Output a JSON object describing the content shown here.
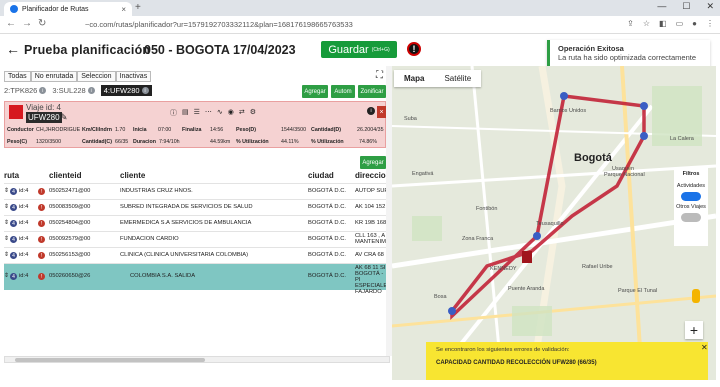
{
  "browser": {
    "tab_title": "Planificador de Rutas",
    "url": "~co.com/rutas/planificador?ur=1579192703332112&plan=168176198665763533"
  },
  "header": {
    "title": "Prueba planificación",
    "code_city": "050 - BOGOTA",
    "date": "17/04/2023",
    "save_label": "Guardar",
    "save_shortcut": "(Ctrl+G)",
    "alert_icon": "!"
  },
  "toast": {
    "title": "Operación Exitosa",
    "message": "La ruta ha sido optimizada correctamente"
  },
  "filters": [
    "Todas",
    "No enrutada",
    "Seleccion",
    "Inactivas"
  ],
  "trip_tabs": [
    {
      "label": "2:TPK826",
      "active": false
    },
    {
      "label": "3:SUL228",
      "active": false
    },
    {
      "label": "4:UFW280",
      "active": true
    }
  ],
  "actions": {
    "add": "Agregar",
    "auto": "Autom",
    "zone": "Zonificar",
    "add2": "Agregar"
  },
  "trip": {
    "id_label": "Viaje id: 4",
    "plate": "UFW280",
    "fields": {
      "conductor_k": "Conductor",
      "conductor_v": "CH,JHRODRIGUE",
      "km_k": "Km/Clilndrn",
      "km_v": "1.70",
      "inicio_k": "Inicia",
      "inicio_v": "07:00",
      "finaliza_k": "Finaliza",
      "finaliza_v": "14:56",
      "peso_k": "Peso(D)",
      "peso_v": "1544/3500",
      "cantidad_k": "Cantidad(D)",
      "cantidad_v": "26.2004/35",
      "pesoc_k": "Peso(C)",
      "pesoc_v": "1320/3500",
      "cantc_k": "Cantidad(C)",
      "cantc_v": "66/35",
      "dur_k": "Duracion",
      "dur_v": "7:94/10h",
      "dist_v": "44.59km",
      "util_k": "% Utilización",
      "util_v": "44.11%",
      "util2_k": "% Utilización",
      "util2_v": "74.86%"
    }
  },
  "table": {
    "headers": [
      "ruta",
      "clienteid",
      "cliente",
      "ciudad",
      "direccion"
    ],
    "rows": [
      {
        "ruta": "id:4",
        "id": "050252471@00",
        "cliente": "INDUSTRIAS CRUZ HNOS.",
        "ciudad": "BOGOTÁ D.C.",
        "dir": "AUTOP SUR"
      },
      {
        "ruta": "id:4",
        "id": "050083509@00",
        "cliente": "SUBRED INTEGRADA DE SERVICIOS DE SALUD",
        "ciudad": "BOGOTÁ D.C.",
        "dir": "AK 104 152"
      },
      {
        "ruta": "id:4",
        "id": "050254804@00",
        "cliente": "EMERMEDICA S.A SERVICIOS DE AMBULANCIA",
        "ciudad": "BOGOTÁ D.C.",
        "dir": "KR 19B 168"
      },
      {
        "ruta": "id:4",
        "id": "050092579@00",
        "cliente": "FUNDACION CARDIO",
        "ciudad": "BOGOTÁ D.C.",
        "dir": "CLL 163 , A MANTENIM"
      },
      {
        "ruta": "id:4",
        "id": "050256153@00",
        "cliente": "CLINICA  (CLINICA UNIVERSITARIA COLOMBIA)",
        "ciudad": "BOGOTÁ D.C.",
        "dir": "AV CRA 68"
      },
      {
        "ruta": "id:4",
        "id": "050260650@26",
        "cliente": "COLOMBIA S.A. SALIDA",
        "ciudad": "BOGOTÁ D.C.",
        "dir": "AK 68 11 SI BOGOTÁ - PI ESPECIALES FAJARDO"
      }
    ]
  },
  "map": {
    "tab_map": "Mapa",
    "tab_sat": "Satélite",
    "city": "Bogotá",
    "labels": [
      "Parque Nacional",
      "Rafael Uribe",
      "Fontibón",
      "KENNEDY",
      "Puente Aranda",
      "Bosa",
      "Usaquén",
      "Teusaquillo",
      "Barrios Unidos",
      "Suba",
      "Engativá",
      "Zona Franca",
      "Parque El Tunal",
      "La Calera"
    ],
    "filters_title": "Filtros",
    "filters_active": "Actividades",
    "filters_other": "Otros Viajes",
    "zoom": "+"
  },
  "error_box": {
    "title": "Se encontraron los siguientes errores de validación:",
    "message": "CAPACIDAD CANTIDAD RECOLECCIÓN UFW280 (66/35)"
  },
  "colors": {
    "route": "#c0172e",
    "save": "#169b3a",
    "selected_row": "#7fc6c2",
    "error_bg": "#f8e531"
  }
}
